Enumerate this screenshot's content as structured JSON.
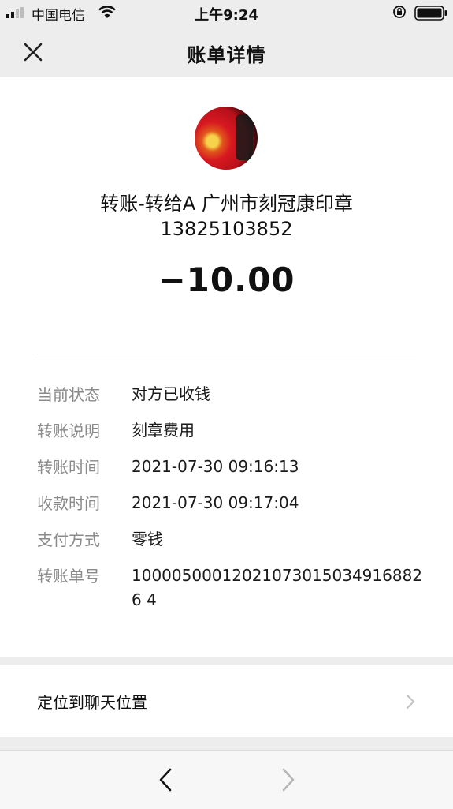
{
  "status_bar": {
    "carrier": "中国电信",
    "time": "上午9:24",
    "signal_icon": "cellular-signal-icon",
    "wifi_icon": "wifi-icon",
    "lock_icon": "orientation-lock-icon",
    "battery_icon": "battery-icon"
  },
  "nav": {
    "title": "账单详情",
    "close_icon": "close-icon"
  },
  "transfer": {
    "payee_name": "转账-转给A 广州市刻冠康印章",
    "payee_phone": "13825103852",
    "amount": "−10.00"
  },
  "details": [
    {
      "label": "当前状态",
      "value": "对方已收钱"
    },
    {
      "label": "转账说明",
      "value": "刻章费用"
    },
    {
      "label": "转账时间",
      "value": "2021-07-30 09:16:13"
    },
    {
      "label": "收款时间",
      "value": "2021-07-30 09:17:04"
    },
    {
      "label": "支付方式",
      "value": "零钱"
    },
    {
      "label": "转账单号",
      "value": "100005000120210730150349168826 4"
    }
  ],
  "locate": {
    "label": "定位到聊天位置",
    "chevron_icon": "chevron-right-icon"
  },
  "toolbar": {
    "back_icon": "chevron-left-icon",
    "forward_icon": "chevron-right-icon"
  },
  "colors": {
    "background": "#ededed",
    "card": "#ffffff",
    "label_gray": "#8a8a8a",
    "disabled_gray": "#b5b5b5"
  }
}
